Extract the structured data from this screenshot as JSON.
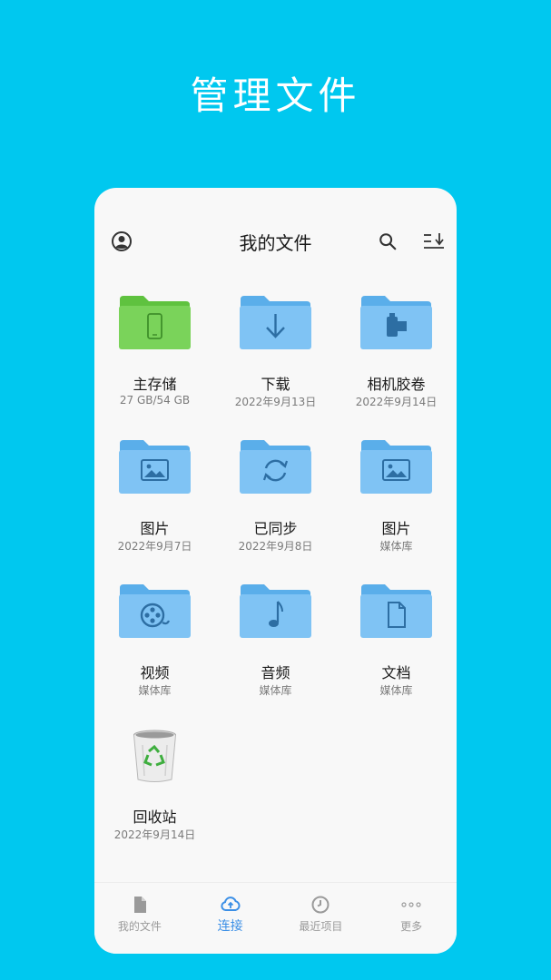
{
  "hero": {
    "title": "管理文件"
  },
  "header": {
    "title": "我的文件"
  },
  "icons": {
    "account": "account-circle-icon",
    "search": "search-icon",
    "sort": "sort-icon"
  },
  "colors": {
    "background": "#00c8ef",
    "card": "#f8f8f8",
    "folder_blue": "#7fc3f4",
    "folder_green": "#7ad35a",
    "accent": "#3b8fe6"
  },
  "items": [
    {
      "label": "主存储",
      "sub": "27 GB/54 GB",
      "icon": "phone-folder-icon"
    },
    {
      "label": "下载",
      "sub": "2022年9月13日",
      "icon": "download-folder-icon"
    },
    {
      "label": "相机胶卷",
      "sub": "2022年9月14日",
      "icon": "camera-roll-folder-icon"
    },
    {
      "label": "图片",
      "sub": "2022年9月7日",
      "icon": "image-folder-icon"
    },
    {
      "label": "已同步",
      "sub": "2022年9月8日",
      "icon": "sync-folder-icon"
    },
    {
      "label": "图片",
      "sub": "媒体库",
      "icon": "image-folder-icon"
    },
    {
      "label": "视频",
      "sub": "媒体库",
      "icon": "video-folder-icon"
    },
    {
      "label": "音频",
      "sub": "媒体库",
      "icon": "music-folder-icon"
    },
    {
      "label": "文档",
      "sub": "媒体库",
      "icon": "document-folder-icon"
    },
    {
      "label": "回收站",
      "sub": "2022年9月14日",
      "icon": "recycle-bin-icon"
    }
  ],
  "nav": [
    {
      "label": "我的文件",
      "icon": "file-icon",
      "active": false
    },
    {
      "label": "连接",
      "icon": "cloud-icon",
      "active": true
    },
    {
      "label": "最近项目",
      "icon": "clock-icon",
      "active": false
    },
    {
      "label": "更多",
      "icon": "more-icon",
      "active": false
    }
  ]
}
